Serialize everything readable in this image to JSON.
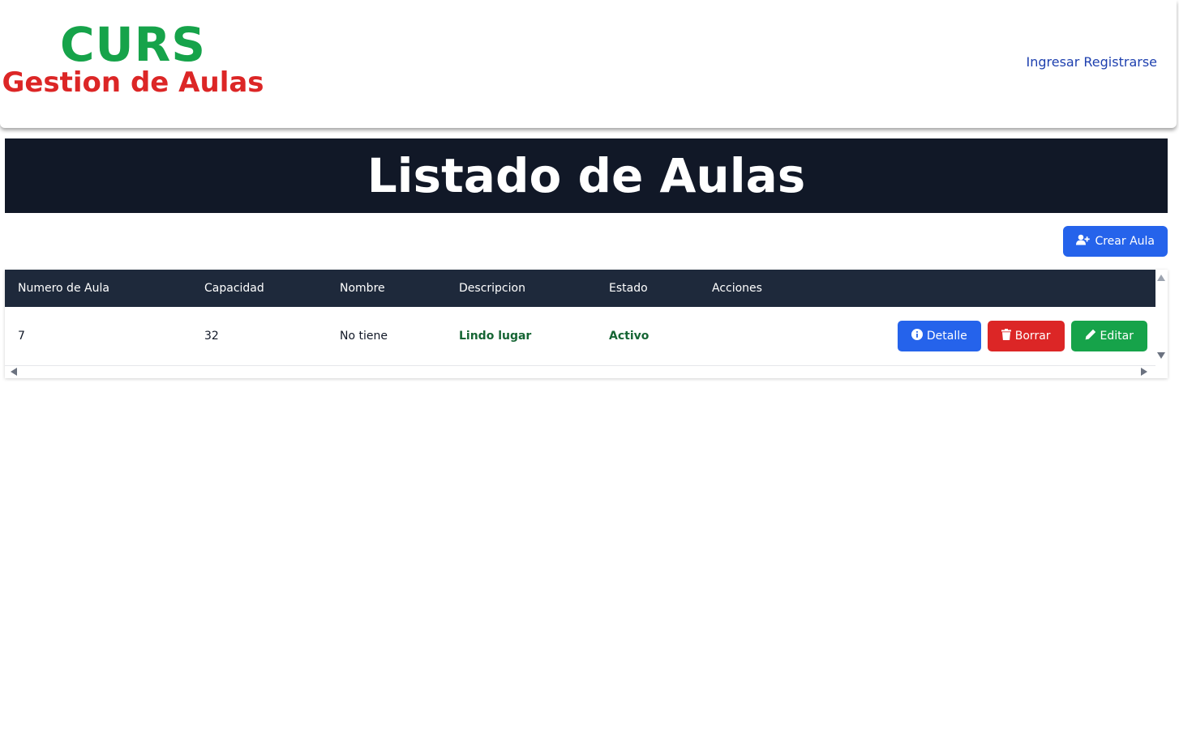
{
  "brand": {
    "title": "CURS",
    "subtitle": "Gestion de Aulas"
  },
  "nav": {
    "login": "Ingresar",
    "register": "Registrarse"
  },
  "page": {
    "heading": "Listado de Aulas"
  },
  "toolbar": {
    "create_label": "Crear Aula",
    "create_icon": "user-plus-icon"
  },
  "table": {
    "columns": [
      "Numero de Aula",
      "Capacidad",
      "Nombre",
      "Descripcion",
      "Estado",
      "Acciones"
    ],
    "rows": [
      {
        "numero": "7",
        "capacidad": "32",
        "nombre": "No tiene",
        "descripcion": "Lindo lugar",
        "estado": "Activo"
      }
    ],
    "row_actions": {
      "detail": "Detalle",
      "delete": "Borrar",
      "edit": "Editar"
    }
  },
  "icons": {
    "detail": "info-circle-icon",
    "delete": "trash-icon",
    "edit": "pencil-icon"
  },
  "colors": {
    "brand_green": "#16a34a",
    "brand_red": "#dc2626",
    "nav_link": "#1e40af",
    "banner_bg": "#111827",
    "table_header_bg": "#1e293b",
    "primary_blue": "#2563eb",
    "danger_red": "#dc2626",
    "success_green": "#16a34a",
    "text_green": "#166534"
  }
}
